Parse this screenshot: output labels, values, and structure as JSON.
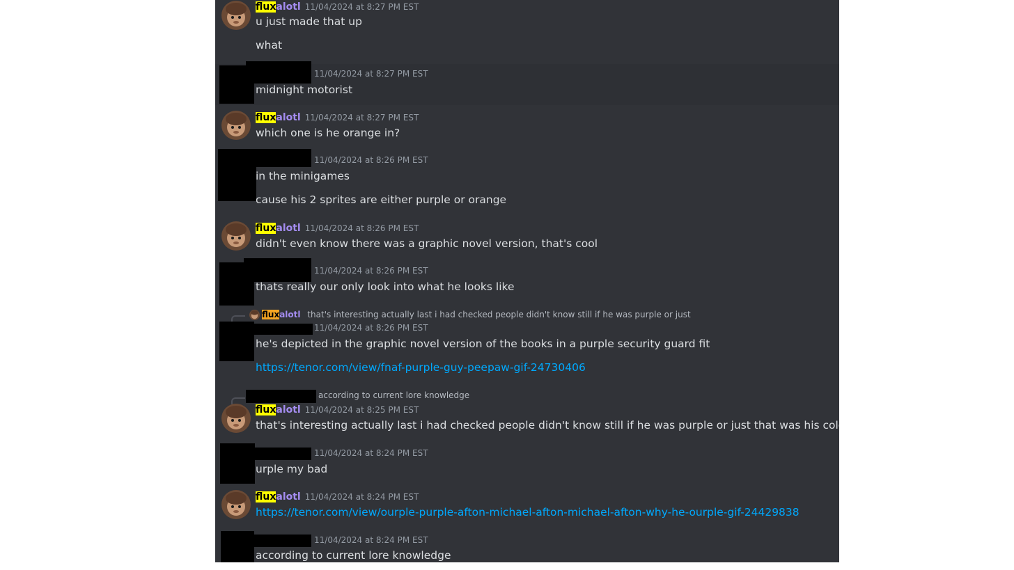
{
  "messages": [
    {
      "author_hl": "flux",
      "author_rest": "alotl",
      "timestamp": "11/04/2024 at 8:27 PM EST",
      "lines": [
        "u just made that up",
        "what"
      ]
    },
    {
      "author_redacted": true,
      "timestamp": "11/04/2024 at 8:27 PM EST",
      "lines": [
        "midnight motorist"
      ]
    },
    {
      "author_hl": "flux",
      "author_rest": "alotl",
      "timestamp": "11/04/2024 at 8:27 PM EST",
      "lines": [
        "which one is he orange in?"
      ]
    },
    {
      "author_redacted": true,
      "timestamp": "11/04/2024 at 8:26 PM EST",
      "lines": [
        "in the minigames",
        "cause his 2 sprites are either purple or orange"
      ]
    },
    {
      "author_hl": "flux",
      "author_rest": "alotl",
      "timestamp": "11/04/2024 at 8:26 PM EST",
      "lines": [
        "didn't even know there was a graphic novel version, that's cool"
      ]
    },
    {
      "author_redacted": true,
      "timestamp": "11/04/2024 at 8:26 PM EST",
      "lines": [
        "thats really our only look into what he looks like"
      ]
    },
    {
      "reply": {
        "author_hl": "flux",
        "author_rest": "alotl",
        "text": "that's interesting actually last i had checked people didn't know still if he was purple or just"
      },
      "author_redacted": true,
      "timestamp": "11/04/2024 at 8:26 PM EST",
      "lines": [
        "he's depicted in the graphic novel version of the books in a purple security guard fit"
      ],
      "link": "https://tenor.com/view/fnaf-purple-guy-peepaw-gif-24730406"
    },
    {
      "reply": {
        "text": "according to current lore knowledge"
      },
      "author_hl": "flux",
      "author_rest": "alotl",
      "timestamp": "11/04/2024 at 8:25 PM EST",
      "lines": [
        "that's interesting actually last i had checked people didn't know still if he was purple or just that was his color"
      ]
    },
    {
      "author_redacted": true,
      "timestamp": "11/04/2024 at 8:24 PM EST",
      "lines": [
        "urple my bad"
      ]
    },
    {
      "author_hl": "flux",
      "author_rest": "alotl",
      "timestamp": "11/04/2024 at 8:24 PM EST",
      "link": "https://tenor.com/view/ourple-purple-afton-michael-afton-michael-afton-why-he-ourple-gif-24429838"
    },
    {
      "author_redacted": true,
      "timestamp": "11/04/2024 at 8:24 PM EST",
      "lines": [
        "according to current lore knowledge"
      ]
    }
  ],
  "colors": {
    "background": "#313338",
    "text": "#dbdee1",
    "timestamp": "#949ba4",
    "link": "#00a8fc",
    "username": "#a48cf0",
    "name_highlight": "#ffff00"
  }
}
